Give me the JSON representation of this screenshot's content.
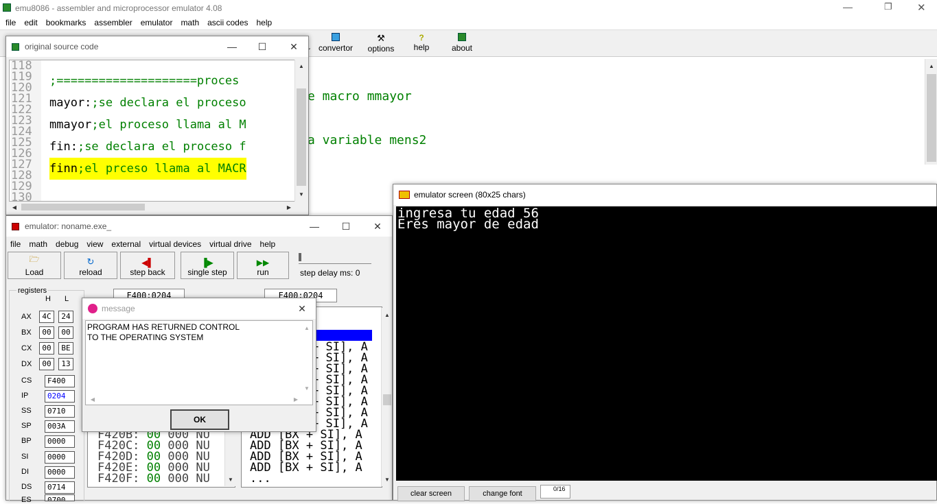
{
  "app": {
    "title": "emu8086 - assembler and microprocessor emulator 4.08",
    "menu": [
      "file",
      "edit",
      "bookmarks",
      "assembler",
      "emulator",
      "math",
      "ascii codes",
      "help"
    ]
  },
  "main_toolbar": {
    "partial": "r",
    "convertor": "convertor",
    "options": "options",
    "help": "help",
    "about": "about"
  },
  "editor_bg_lines": [
    {
      "text": "e macro mmayor"
    },
    {
      "text": "a variable mens2"
    }
  ],
  "source_window": {
    "title": "original source code",
    "line_numbers": [
      "118",
      "119",
      "120",
      "121",
      "122",
      "123",
      "124",
      "125",
      "126",
      "127",
      "128",
      "129",
      "130"
    ],
    "lines": [
      {
        "code": ";====================proces",
        "cls": "green"
      },
      {
        "code": "",
        "cls": ""
      },
      {
        "code": "mayor:;se declara el proceso",
        "cls": "mixed",
        "label": "mayor:",
        "comment": ";se declara el proceso"
      },
      {
        "code": "",
        "cls": ""
      },
      {
        "code": "mmayor;el proceso llama al M",
        "cls": "mixed",
        "label": "mmayor",
        "comment": ";el proceso llama al M"
      },
      {
        "code": "",
        "cls": ""
      },
      {
        "code": "",
        "cls": ""
      },
      {
        "code": "",
        "cls": ""
      },
      {
        "code": "fin:;se declara el proceso f",
        "cls": "mixed",
        "label": "fin:",
        "comment": ";se declara el proceso f"
      },
      {
        "code": "",
        "cls": ""
      },
      {
        "code": "finn;el prceso llama al MACR",
        "cls": "mixed",
        "label": "finn",
        "comment": ";el prceso llama al MACR"
      }
    ]
  },
  "emulator_window": {
    "title": "emulator: noname.exe_",
    "menu": [
      "file",
      "math",
      "debug",
      "view",
      "external",
      "virtual devices",
      "virtual drive",
      "help"
    ],
    "toolbar": {
      "load": "Load",
      "reload": "reload",
      "step_back": "step back",
      "single_step": "single step",
      "run": "run",
      "step_delay": "step delay ms: 0"
    },
    "address_left": "F400:0204",
    "address_right": "F400:0204",
    "registers": {
      "title": "registers",
      "h": "H",
      "l": "L",
      "ax": {
        "label": "AX",
        "h": "4C",
        "l": "24"
      },
      "bx": {
        "label": "BX",
        "h": "00",
        "l": "00"
      },
      "cx": {
        "label": "CX",
        "h": "00",
        "l": "BE"
      },
      "dx": {
        "label": "DX",
        "h": "00",
        "l": "13"
      },
      "cs": {
        "label": "CS",
        "v": "F400"
      },
      "ip": {
        "label": "IP",
        "v": "0204"
      },
      "ss": {
        "label": "SS",
        "v": "0710"
      },
      "sp": {
        "label": "SP",
        "v": "003A"
      },
      "bp": {
        "label": "BP",
        "v": "0000"
      },
      "si": {
        "label": "SI",
        "v": "0000"
      },
      "di": {
        "label": "DI",
        "v": "0000"
      },
      "ds": {
        "label": "DS",
        "v": "0714"
      },
      "es": {
        "label": "ES",
        "v": "0700"
      }
    },
    "memory_rows": [
      {
        "addr": "F420B:",
        "b1": "00",
        "b2": "000",
        "c": "NU"
      },
      {
        "addr": "F420C:",
        "b1": "00",
        "b2": "000",
        "c": "NU"
      },
      {
        "addr": "F420D:",
        "b1": "00",
        "b2": "000",
        "c": "NU"
      },
      {
        "addr": "F420E:",
        "b1": "00",
        "b2": "000",
        "c": "NU"
      },
      {
        "addr": "F420F:",
        "b1": "00",
        "b2": "000",
        "c": "NU"
      }
    ],
    "disasm_rows": [
      "+ SI], A",
      "+ SI], A",
      "+ SI], A",
      "+ SI], A",
      "+ SI], A",
      "+ SI], A",
      "+ SI], A",
      "+ SI], A",
      "ADD [BX + SI], A",
      "ADD [BX + SI], A",
      "ADD [BX + SI], A",
      "ADD [BX + SI], A",
      "..."
    ]
  },
  "message": {
    "title": "message",
    "text1": "PROGRAM HAS RETURNED CONTROL",
    "text2": "TO THE OPERATING SYSTEM",
    "ok": "OK"
  },
  "screen": {
    "title": "emulator screen (80x25 chars)",
    "line1": "ingresa tu edad 56",
    "line2": "Eres mayor de edad",
    "clear": "clear screen",
    "font": "change font",
    "counter": "0/16"
  },
  "colors": {
    "green": "#008000",
    "highlight": "#ffff00",
    "console_bg": "#000000",
    "console_fg": "#ffffff",
    "blue_sel": "#0000ff"
  }
}
